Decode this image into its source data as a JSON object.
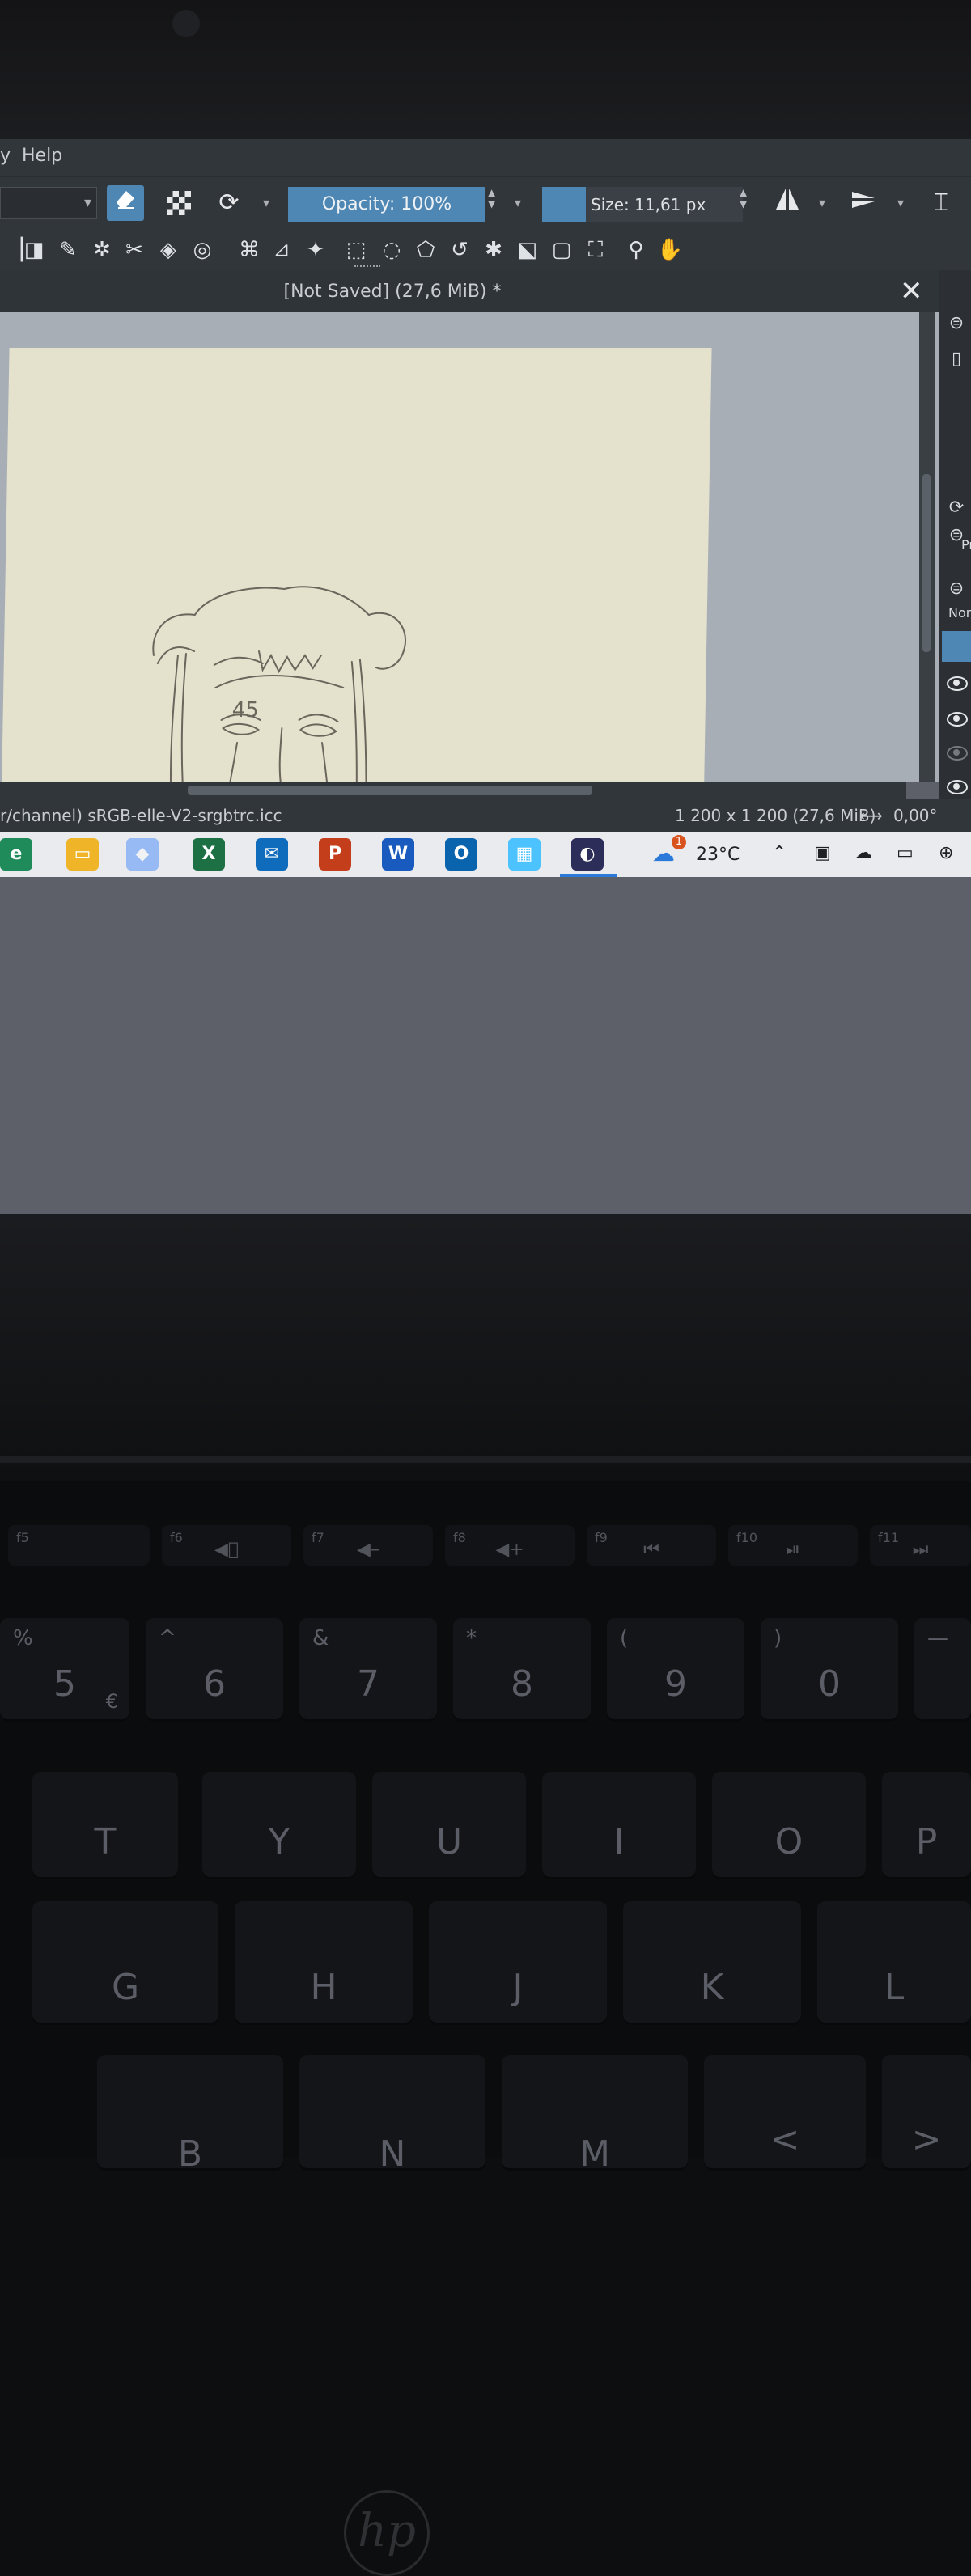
{
  "menu": {
    "help_label": "Help",
    "cut_label": "y"
  },
  "toolbar": {
    "opacity_label": "Opacity: 100%",
    "size_label": "Size: 11,61 px",
    "accent_color": "#4f87b4"
  },
  "document": {
    "title": "[Not Saved]  (27,6 MiB) *",
    "close_glyph": "✕",
    "sketch_label": "45"
  },
  "dockers": {
    "p_label": "Pr",
    "blend_label": "Nor"
  },
  "statusbar": {
    "profile": "r/channel)  sRGB-elle-V2-srgbtrc.icc",
    "image_size": "1 200 x 1 200 (27,6 MiB)",
    "rotation": "0,00°"
  },
  "taskbar": {
    "apps": [
      "Edge",
      "File Explorer",
      "Dropbox",
      "Excel",
      "Mail",
      "PowerPoint",
      "Word",
      "Outlook",
      "Microsoft Store",
      "Krita"
    ],
    "weather_temp": "23°C",
    "weather_alert": "1"
  },
  "keyboard": {
    "function_keys": [
      {
        "fn": "f5",
        "icon": "🔇"
      },
      {
        "fn": "f6",
        "icon": "◀⃠"
      },
      {
        "fn": "f7",
        "icon": "◀–"
      },
      {
        "fn": "f8",
        "icon": "◀+"
      },
      {
        "fn": "f9",
        "icon": "⏮"
      },
      {
        "fn": "f10",
        "icon": "⏯"
      },
      {
        "fn": "f11",
        "icon": "⏭"
      }
    ],
    "number_row": [
      {
        "top": "%",
        "main": "5",
        "corner": "€"
      },
      {
        "top": "^",
        "main": "6",
        "corner": ""
      },
      {
        "top": "&",
        "main": "7",
        "corner": ""
      },
      {
        "top": "*",
        "main": "8",
        "corner": ""
      },
      {
        "top": "(",
        "main": "9",
        "corner": ""
      },
      {
        "top": ")",
        "main": "0",
        "corner": ""
      },
      {
        "top": "—",
        "main": "",
        "corner": ""
      }
    ],
    "letter_row_1": [
      "T",
      "Y",
      "U",
      "I",
      "O",
      "P"
    ],
    "letter_row_2": [
      "G",
      "H",
      "J",
      "K",
      "L"
    ],
    "letter_row_3": [
      "B",
      "N",
      "M"
    ],
    "brand": "hp"
  }
}
